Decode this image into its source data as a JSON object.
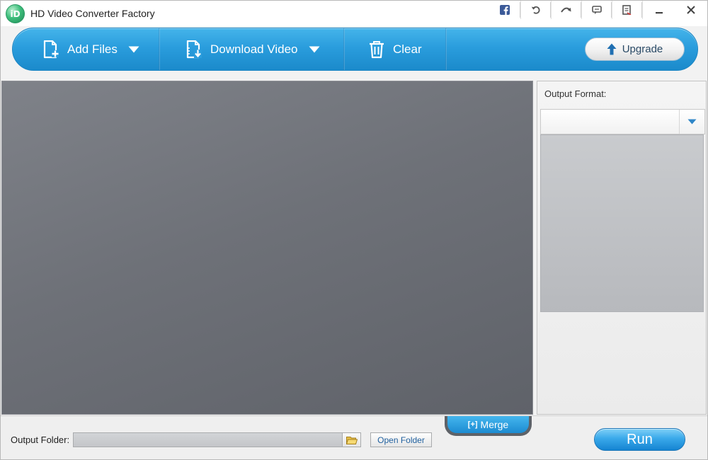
{
  "window": {
    "title": "HD Video Converter Factory",
    "logo_text": "iD"
  },
  "titlebar_icons": [
    {
      "name": "facebook-icon"
    },
    {
      "name": "undo-icon"
    },
    {
      "name": "skip-icon"
    },
    {
      "name": "feedback-icon"
    },
    {
      "name": "register-icon"
    },
    {
      "name": "minimize-icon"
    },
    {
      "name": "close-icon"
    }
  ],
  "toolbar": {
    "add_files_label": "Add Files",
    "download_video_label": "Download Video",
    "clear_label": "Clear",
    "upgrade_label": "Upgrade"
  },
  "right_panel": {
    "output_format_label": "Output Format:",
    "selected_format": ""
  },
  "bottom": {
    "merge_label": "Merge",
    "merge_icon_glyph": "[+]",
    "output_folder_label": "Output Folder:",
    "output_folder_value": "",
    "open_folder_label": "Open Folder",
    "run_label": "Run"
  },
  "colors": {
    "toolbar_blue": "#2a9ddd",
    "workspace_gray": "#6e7178",
    "run_blue": "#3aa9ea"
  }
}
